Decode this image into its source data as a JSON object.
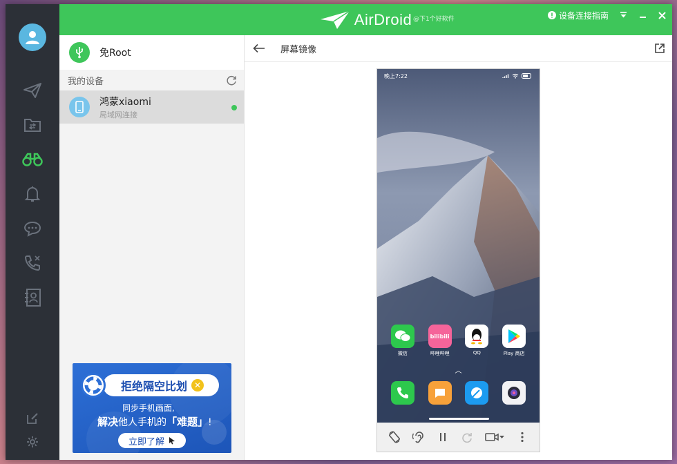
{
  "titlebar": {
    "app_name": "AirDroid",
    "watermark": "@下1个好软件",
    "guide_label": "设备连接指南"
  },
  "device_panel": {
    "root_label": "免Root",
    "section_title": "我的设备",
    "devices": [
      {
        "name": "鸿蒙xiaomi",
        "connection": "局域网连接",
        "status": "online"
      }
    ]
  },
  "ad": {
    "title": "拒绝隔空比划",
    "line1": "同步手机画面,",
    "line2_pre": "解决",
    "line2_mid": "他人手机的",
    "line2_em": "「难题」",
    "line2_end": "!",
    "cta": "立即了解"
  },
  "mirror": {
    "title": "屏幕镜像",
    "phone": {
      "status_time": "晚上7:22",
      "apps_row1": [
        {
          "label": "微信",
          "icon": "wechat-icon",
          "color": "#2dc84d"
        },
        {
          "label": "哔哩哔哩",
          "icon": "bilibili-icon",
          "color": "#f5649a"
        },
        {
          "label": "QQ",
          "icon": "qq-icon",
          "color": "#ffffff"
        },
        {
          "label": "Play 商店",
          "icon": "play-store-icon",
          "color": "#ffffff"
        }
      ],
      "dock": [
        {
          "icon": "phone-icon",
          "color": "#2dc84d"
        },
        {
          "icon": "messages-icon",
          "color": "#f7a13a"
        },
        {
          "icon": "browser-icon",
          "color": "#1c9bf0"
        },
        {
          "icon": "camera-icon",
          "color": "#f2f2f5"
        }
      ]
    }
  },
  "colors": {
    "brand_green": "#3ec65a",
    "rail_bg": "#2c3037",
    "ad_blue": "#2d6fd6"
  }
}
